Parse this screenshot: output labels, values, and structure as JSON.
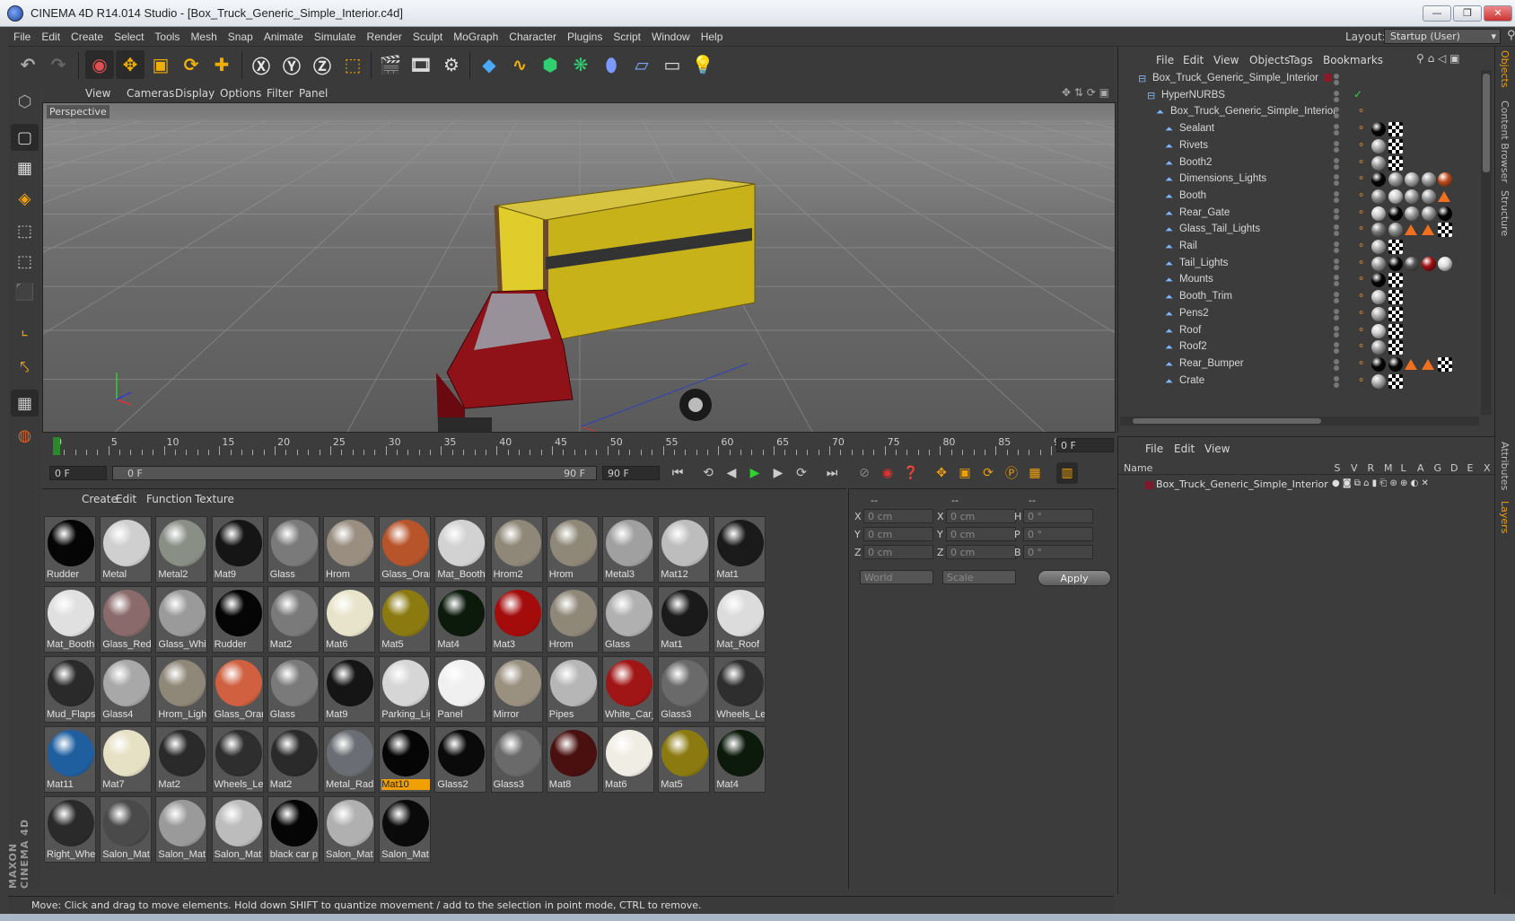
{
  "window": {
    "title": "CINEMA 4D R14.014 Studio - [Box_Truck_Generic_Simple_Interior.c4d]",
    "min": "—",
    "max": "❐",
    "close": "✕"
  },
  "menu": [
    "File",
    "Edit",
    "Create",
    "Select",
    "Tools",
    "Mesh",
    "Snap",
    "Animate",
    "Simulate",
    "Render",
    "Sculpt",
    "MoGraph",
    "Character",
    "Plugins",
    "Script",
    "Window",
    "Help"
  ],
  "layout": {
    "label": "Layout:",
    "value": "Startup (User)"
  },
  "viewport": {
    "menu": [
      "View",
      "Cameras",
      "Display",
      "Options",
      "Filter",
      "Panel"
    ],
    "label": "Perspective"
  },
  "timeline": {
    "ticks": [
      "0",
      "5",
      "10",
      "15",
      "20",
      "25",
      "30",
      "35",
      "40",
      "45",
      "50",
      "55",
      "60",
      "65",
      "70",
      "75",
      "80",
      "85",
      "90"
    ],
    "current_frame": "0 F"
  },
  "transport": {
    "start": "0 F",
    "range_start": "0 F",
    "range_end": "90 F",
    "end": "90 F"
  },
  "materials": {
    "menu": [
      "Create",
      "Edit",
      "Function",
      "Texture"
    ],
    "items": [
      {
        "name": "Rudder",
        "color": "#050505"
      },
      {
        "name": "Metal",
        "color": "#cfcfcf"
      },
      {
        "name": "Metal2",
        "color": "#8a8f86"
      },
      {
        "name": "Mat9",
        "color": "#151515"
      },
      {
        "name": "Glass",
        "color": "#7a7a7a"
      },
      {
        "name": "Hrom",
        "color": "#9a8e80"
      },
      {
        "name": "Glass_Orang",
        "color": "#b8542a"
      },
      {
        "name": "Mat_Booth",
        "color": "#d2d2d2"
      },
      {
        "name": "Hrom2",
        "color": "#8f8778"
      },
      {
        "name": "Hrom",
        "color": "#8f8778"
      },
      {
        "name": "Metal3",
        "color": "#a0a0a0"
      },
      {
        "name": "Mat12",
        "color": "#bdbdbd"
      },
      {
        "name": "Mat1",
        "color": "#1a1a1a"
      },
      {
        "name": "Mat_Booth",
        "color": "#e0e0e0"
      },
      {
        "name": "Glass_Red",
        "color": "#8a6a6a"
      },
      {
        "name": "Glass_White",
        "color": "#9a9a9a"
      },
      {
        "name": "Rudder",
        "color": "#050505"
      },
      {
        "name": "Mat2",
        "color": "#7a7a7a"
      },
      {
        "name": "Mat6",
        "color": "#e8e4cc"
      },
      {
        "name": "Mat5",
        "color": "#8a7a10"
      },
      {
        "name": "Mat4",
        "color": "#0c1a0c"
      },
      {
        "name": "Mat3",
        "color": "#a40c0c"
      },
      {
        "name": "Hrom",
        "color": "#8f8778"
      },
      {
        "name": "Glass",
        "color": "#b0b0b0"
      },
      {
        "name": "Mat1",
        "color": "#1a1a1a"
      },
      {
        "name": "Mat_Roof",
        "color": "#dcdcdc"
      },
      {
        "name": "Mud_Flaps",
        "color": "#2a2a2a"
      },
      {
        "name": "Glass4",
        "color": "#a8a8a8"
      },
      {
        "name": "Hrom_Light",
        "color": "#8f8778"
      },
      {
        "name": "Glass_Orang",
        "color": "#d06040"
      },
      {
        "name": "Glass",
        "color": "#7a7a7a"
      },
      {
        "name": "Mat9",
        "color": "#151515"
      },
      {
        "name": "Parking_Lig",
        "color": "#d6d6d6"
      },
      {
        "name": "Panel",
        "color": "#f0f0f0"
      },
      {
        "name": "Mirror",
        "color": "#9a9080"
      },
      {
        "name": "Pipes",
        "color": "#b6b6b6"
      },
      {
        "name": "White_Car_",
        "color": "#a01515"
      },
      {
        "name": "Glass3",
        "color": "#6a6a6a"
      },
      {
        "name": "Wheels_Lef",
        "color": "#2e2e2e"
      },
      {
        "name": "Mat11",
        "color": "#1f5fa0"
      },
      {
        "name": "Mat7",
        "color": "#e6e0c4"
      },
      {
        "name": "Mat2",
        "color": "#2a2a2a"
      },
      {
        "name": "Wheels_Lef",
        "color": "#2e2e2e"
      },
      {
        "name": "Mat2",
        "color": "#2a2a2a"
      },
      {
        "name": "Metal_Radi",
        "color": "#6a6e74"
      },
      {
        "name": "Mat10",
        "color": "#050505"
      },
      {
        "name": "Glass2",
        "color": "#0a0a0a"
      },
      {
        "name": "Glass3",
        "color": "#6a6a6a"
      },
      {
        "name": "Mat8",
        "color": "#4a1010"
      },
      {
        "name": "Mat6",
        "color": "#f0eee4"
      },
      {
        "name": "Mat5",
        "color": "#8a7a10"
      },
      {
        "name": "Mat4",
        "color": "#0c1a0c"
      },
      {
        "name": "Right_Whe",
        "color": "#2a2a2a"
      },
      {
        "name": "Salon_Mat",
        "color": "#4a4a4a"
      },
      {
        "name": "Salon_Mat",
        "color": "#9a9a9a"
      },
      {
        "name": "Salon_Mat",
        "color": "#bcbcbc"
      },
      {
        "name": "black car p",
        "color": "#050505"
      },
      {
        "name": "Salon_Mat",
        "color": "#b0b0b0"
      },
      {
        "name": "Salon_Mat",
        "color": "#0a0a0a"
      }
    ],
    "selected": "Mat10"
  },
  "coords": {
    "headers": [
      "--",
      "--",
      "--"
    ],
    "rows": [
      {
        "a": "X",
        "av": "0 cm",
        "b": "X",
        "bv": "0 cm",
        "c": "H",
        "cv": "0 °"
      },
      {
        "a": "Y",
        "av": "0 cm",
        "b": "Y",
        "bv": "0 cm",
        "c": "P",
        "cv": "0 °"
      },
      {
        "a": "Z",
        "av": "0 cm",
        "b": "Z",
        "bv": "0 cm",
        "c": "B",
        "cv": "0 °"
      }
    ],
    "mode1": "World",
    "mode2": "Scale",
    "apply": "Apply"
  },
  "objects": {
    "menu": [
      "File",
      "Edit",
      "View",
      "Objects",
      "Tags",
      "Bookmarks"
    ],
    "rows": [
      {
        "name": "Box_Truck_Generic_Simple_Interior",
        "indent": 0,
        "tags": []
      },
      {
        "name": "HyperNURBS",
        "indent": 1,
        "tags": []
      },
      {
        "name": "Box_Truck_Generic_Simple_Interior",
        "indent": 2,
        "tags": []
      },
      {
        "name": "Sealant",
        "indent": 3,
        "tags": [
          "#050505",
          "#chk"
        ]
      },
      {
        "name": "Rivets",
        "indent": 3,
        "tags": [
          "#aaaaaa",
          "#chk"
        ]
      },
      {
        "name": "Booth2",
        "indent": 3,
        "tags": [
          "#9a9a9a",
          "#chk"
        ]
      },
      {
        "name": "Dimensions_Lights",
        "indent": 3,
        "tags": [
          "#050505",
          "#9a9a9a",
          "#aaaaaa",
          "#9a9a9a",
          "#c05020"
        ]
      },
      {
        "name": "Booth",
        "indent": 3,
        "tags": [
          "#8a8a8a",
          "#cccccc",
          "#9a9a9a",
          "#9a9a9a",
          "#tri"
        ]
      },
      {
        "name": "Rear_Gate",
        "indent": 3,
        "tags": [
          "#cccccc",
          "#050505",
          "#9a9a9a",
          "#9a9a9a",
          "#050505"
        ]
      },
      {
        "name": "Glass_Tail_Lights",
        "indent": 3,
        "tags": [
          "#777777",
          "#888888",
          "#tri",
          "#tri",
          "#chk"
        ]
      },
      {
        "name": "Rail",
        "indent": 3,
        "tags": [
          "#aaaaaa",
          "#chk"
        ]
      },
      {
        "name": "Tail_Lights",
        "indent": 3,
        "tags": [
          "#9a9a9a",
          "#050505",
          "#555555",
          "#a01010",
          "#dddddd"
        ]
      },
      {
        "name": "Mounts",
        "indent": 3,
        "tags": [
          "#050505",
          "#chk"
        ]
      },
      {
        "name": "Booth_Trim",
        "indent": 3,
        "tags": [
          "#bbbbbb",
          "#chk"
        ]
      },
      {
        "name": "Pens2",
        "indent": 3,
        "tags": [
          "#aaaaaa",
          "#chk"
        ]
      },
      {
        "name": "Roof",
        "indent": 3,
        "tags": [
          "#cccccc",
          "#chk"
        ]
      },
      {
        "name": "Roof2",
        "indent": 3,
        "tags": [
          "#9a9a9a",
          "#chk"
        ]
      },
      {
        "name": "Rear_Bumper",
        "indent": 3,
        "tags": [
          "#050505",
          "#050505",
          "#tri",
          "#tri",
          "#chk"
        ]
      },
      {
        "name": "Crate",
        "indent": 3,
        "tags": [
          "#aaaaaa",
          "#chk"
        ]
      }
    ]
  },
  "layers": {
    "menu": [
      "File",
      "Edit",
      "View"
    ],
    "columns": [
      "Name",
      "S",
      "V",
      "R",
      "M",
      "L",
      "A",
      "G",
      "D",
      "E",
      "X"
    ],
    "rows": [
      {
        "name": "Box_Truck_Generic_Simple_Interior"
      }
    ]
  },
  "side_tabs": [
    "Objects",
    "Content Browser",
    "Structure"
  ],
  "side_tabs2": [
    "Attributes",
    "Layers"
  ],
  "brand": "MAXON CINEMA 4D",
  "status": "Move: Click and drag to move elements. Hold down SHIFT to quantize movement / add to the selection in point mode, CTRL to remove."
}
